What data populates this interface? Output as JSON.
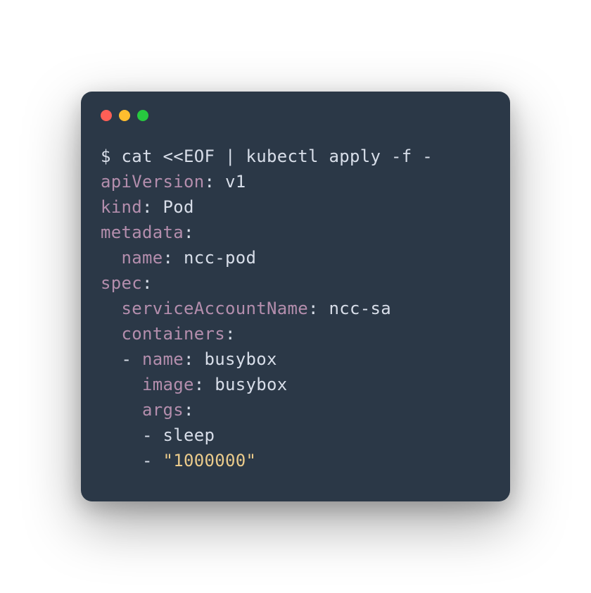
{
  "terminal": {
    "traffic_lights": [
      "red",
      "yellow",
      "green"
    ],
    "prompt": "$ ",
    "command": "cat <<EOF | kubectl apply -f -",
    "yaml": {
      "lines": [
        {
          "indent": "",
          "key": "apiVersion",
          "sep": ": ",
          "value": "v1",
          "value_type": "plain"
        },
        {
          "indent": "",
          "key": "kind",
          "sep": ": ",
          "value": "Pod",
          "value_type": "plain"
        },
        {
          "indent": "",
          "key": "metadata",
          "sep": ":",
          "value": "",
          "value_type": "plain"
        },
        {
          "indent": "  ",
          "key": "name",
          "sep": ": ",
          "value": "ncc-pod",
          "value_type": "plain"
        },
        {
          "indent": "",
          "key": "spec",
          "sep": ":",
          "value": "",
          "value_type": "plain"
        },
        {
          "indent": "  ",
          "key": "serviceAccountName",
          "sep": ": ",
          "value": "ncc-sa",
          "value_type": "plain"
        },
        {
          "indent": "  ",
          "key": "containers",
          "sep": ":",
          "value": "",
          "value_type": "plain"
        },
        {
          "indent": "  - ",
          "key": "name",
          "sep": ": ",
          "value": "busybox",
          "value_type": "plain"
        },
        {
          "indent": "    ",
          "key": "image",
          "sep": ": ",
          "value": "busybox",
          "value_type": "plain"
        },
        {
          "indent": "    ",
          "key": "args",
          "sep": ":",
          "value": "",
          "value_type": "plain"
        },
        {
          "indent": "    - ",
          "key": "",
          "sep": "",
          "value": "sleep",
          "value_type": "plain"
        },
        {
          "indent": "    - ",
          "key": "",
          "sep": "",
          "value": "\"1000000\"",
          "value_type": "str"
        }
      ]
    }
  }
}
